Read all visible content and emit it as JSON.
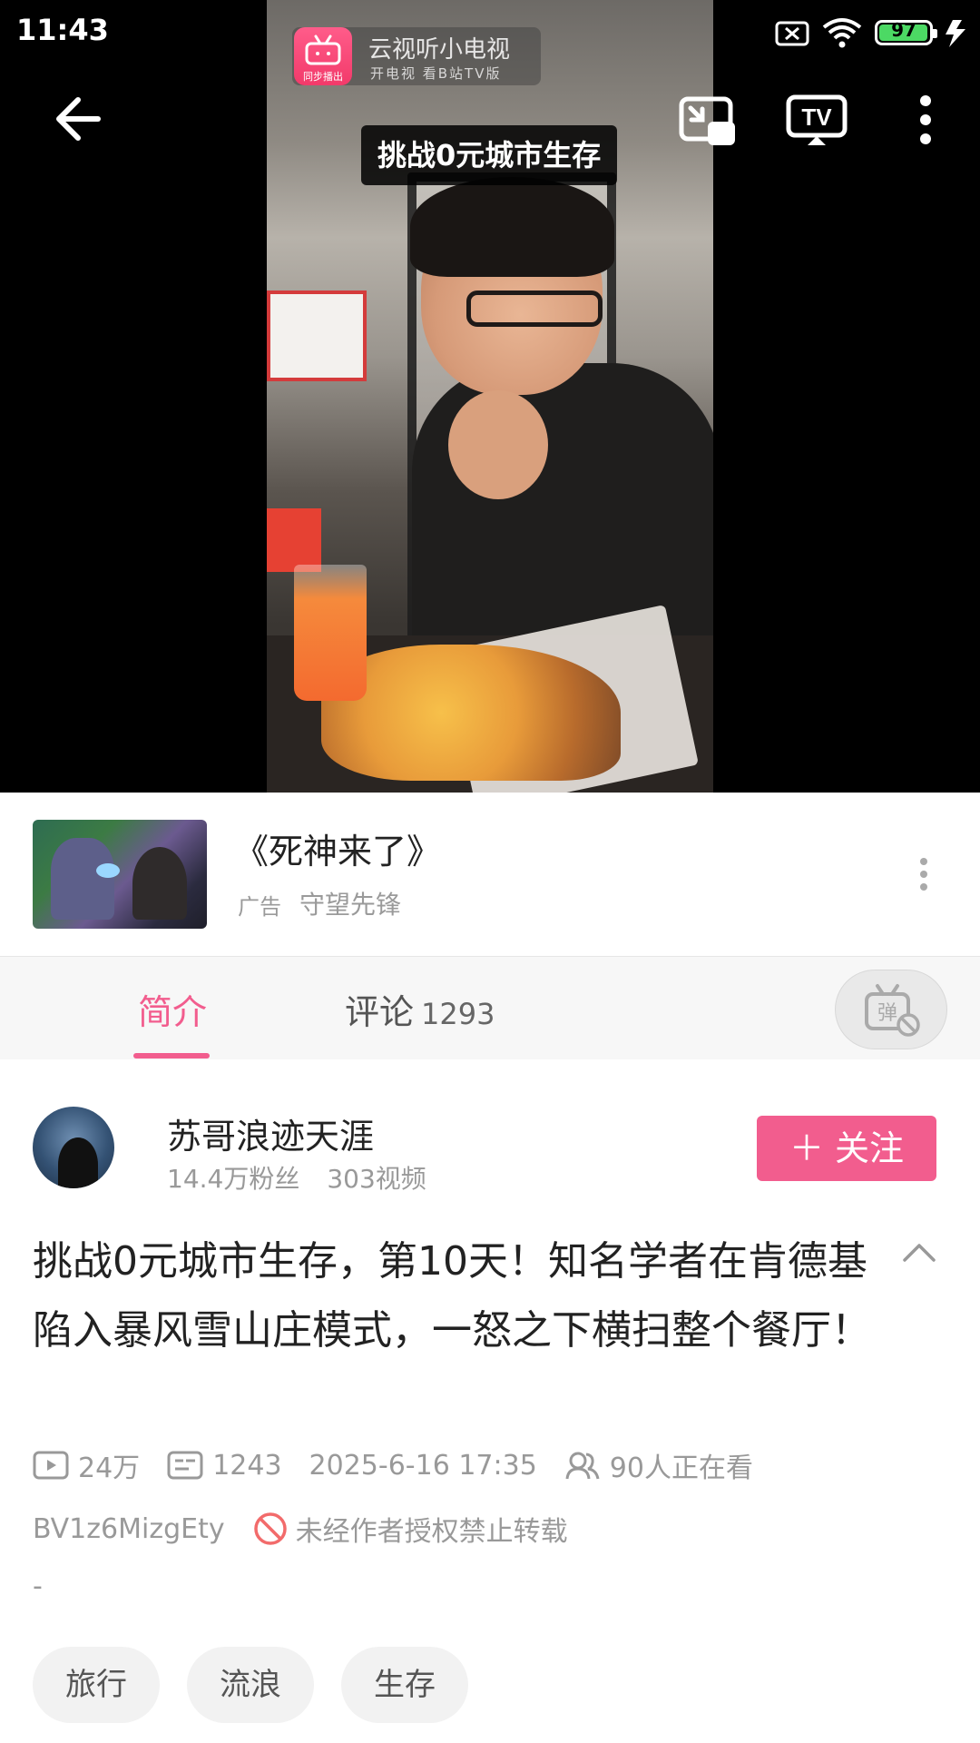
{
  "status_bar": {
    "time": "11:43",
    "battery": "97"
  },
  "video": {
    "caption": "挑战0元城市生存",
    "watermark_title": "云视听小电视",
    "watermark_sub": "开电视 看B站TV版",
    "watermark_badge": "同步播出"
  },
  "ad": {
    "title": "《死神来了》",
    "tag": "广告",
    "name": "守望先锋"
  },
  "tabs": {
    "intro": "简介",
    "comments": "评论",
    "comments_count": "1293",
    "danmaku_glyph": "弹"
  },
  "uploader": {
    "name": "苏哥浪迹天涯",
    "fans": "14.4万粉丝",
    "videos": "303视频",
    "follow_label": "＋ 关注"
  },
  "video_info": {
    "title": "挑战0元城市生存，第10天！知名学者在肯德基陷入暴风雪山庄模式，一怒之下横扫整个餐厅！",
    "views": "24万",
    "danmaku": "1243",
    "date": "2025-6-16 17:35",
    "watching": "90人正在看",
    "bvid": "BV1z6MizgEty",
    "no_reprint": "未经作者授权禁止转载",
    "description": "-"
  },
  "tags": [
    "旅行",
    "流浪",
    "生存"
  ],
  "colors": {
    "accent": "#f25d8e",
    "battery_green": "#4cd964"
  }
}
